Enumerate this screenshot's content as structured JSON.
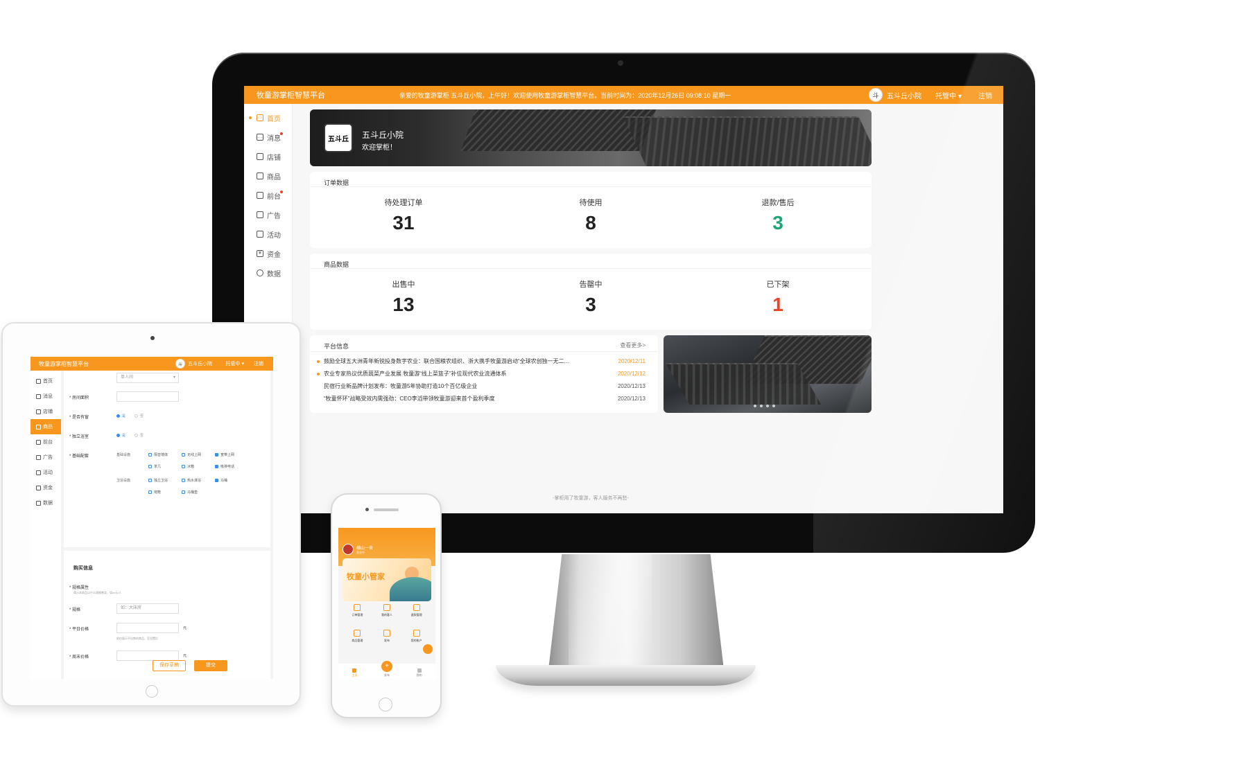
{
  "desktop": {
    "brand": "牧童游掌柜智慧平台",
    "greeting": "亲爱的牧童游掌柜  五斗丘小院，上午好！欢迎使用牧童游掌柜智慧平台。当前时间为：2020年12月26日  09:08:10  星期一",
    "user_name": "五斗丘小院",
    "shop_menu": "托管中",
    "logout": "注销",
    "nav": [
      {
        "label": "首页",
        "icon": "home-icon"
      },
      {
        "label": "消息",
        "icon": "message-icon"
      },
      {
        "label": "店铺",
        "icon": "store-icon"
      },
      {
        "label": "商品",
        "icon": "goods-icon"
      },
      {
        "label": "前台",
        "icon": "reception-icon"
      },
      {
        "label": "广告",
        "icon": "ad-icon"
      },
      {
        "label": "活动",
        "icon": "activity-icon"
      },
      {
        "label": "资金",
        "icon": "money-icon"
      },
      {
        "label": "数据",
        "icon": "chart-icon"
      }
    ],
    "banner": {
      "shop_name": "五斗丘小院",
      "welcome": "欢迎掌柜！",
      "logo_text": "五斗丘"
    },
    "orders": {
      "title": "订单数据",
      "stats": [
        {
          "label": "待处理订单",
          "value": "31",
          "color": "#222222"
        },
        {
          "label": "待使用",
          "value": "8",
          "color": "#222222"
        },
        {
          "label": "退款/售后",
          "value": "3",
          "color": "#1ea672"
        }
      ]
    },
    "goods": {
      "title": "商品数据",
      "stats": [
        {
          "label": "出售中",
          "value": "13",
          "color": "#222222"
        },
        {
          "label": "告罄中",
          "value": "3",
          "color": "#222222"
        },
        {
          "label": "已下架",
          "value": "1",
          "color": "#e8452d"
        }
      ]
    },
    "news": {
      "title": "平台信息",
      "more": "查看更多>",
      "items": [
        {
          "text": "鼓励全球五大洲青年新锐投身数字农业：联合国粮农组织、浙大携手牧童游启动“全球农创独一无二...",
          "date": "2020/12/11"
        },
        {
          "text": "农业专家热议优质蔬菜产业发展  牧童游“线上菜篮子”补位现代农业流通体系",
          "date": "2020/12/12"
        },
        {
          "text": "民宿行业新品牌计划发布：牧童游5年协助打造10个百亿级企业",
          "date": "2020/12/13"
        },
        {
          "text": "“牧童怀环”战略受效内需强劲：CEO李滔带领牧童游迎来首个盈利季度",
          "date": "2020/12/13"
        }
      ]
    },
    "footer": "-掌柜用了牧童游，客人服务不再愁-"
  },
  "tablet": {
    "brand": "牧童游掌柜智慧平台",
    "user_name": "五斗丘小院",
    "shop_menu": "托管中",
    "logout": "注销",
    "nav": [
      {
        "label": "首页"
      },
      {
        "label": "消息"
      },
      {
        "label": "店铺"
      },
      {
        "label": "商品"
      },
      {
        "label": "前台"
      },
      {
        "label": "广告"
      },
      {
        "label": "活动"
      },
      {
        "label": "资金"
      },
      {
        "label": "数据"
      }
    ],
    "form": {
      "room_type_value": "单人间",
      "area_label": "房间面积",
      "window_label": "是否有窗",
      "smoke_label": "独立浴室",
      "yes": "是",
      "no": "否",
      "facility_label": "基础配套",
      "basic_group": "基础设施",
      "basic_items": [
        "隔音墙体",
        "无线上网",
        "宽带上网",
        "茶几",
        "冰箱",
        "吸排电话"
      ],
      "bath_group": "卫浴设施",
      "bath_items": [
        "独立卫浴",
        "热水淋浴",
        "马桶",
        "拖鞋",
        "马桶垫"
      ],
      "purchase_title": "购买信息",
      "spec_label": "规格属性",
      "spec_hint": "简示本商品以什么规格售卖，如xx元/人",
      "spec_name_label": "规格",
      "spec_placeholder": "如：大床房",
      "weekday_label": "平日价格",
      "weekday_hint": "前仅展示不出售的商品，至设置后",
      "weekend_label": "周末价格",
      "unit": "元",
      "save_draft": "保存草稿",
      "submit": "提交"
    }
  },
  "phone": {
    "name": "横山一舍",
    "sub": "营业中",
    "banner_title": "牧童小管家",
    "grid": [
      "订单管理",
      "我的客人",
      "退款管理",
      "商品管理",
      "发布",
      "我的账户"
    ],
    "tabs": [
      "主页",
      "发布",
      "我的"
    ]
  },
  "colors": {
    "accent": "#f7971e",
    "green": "#1ea672",
    "red": "#e8452d"
  }
}
